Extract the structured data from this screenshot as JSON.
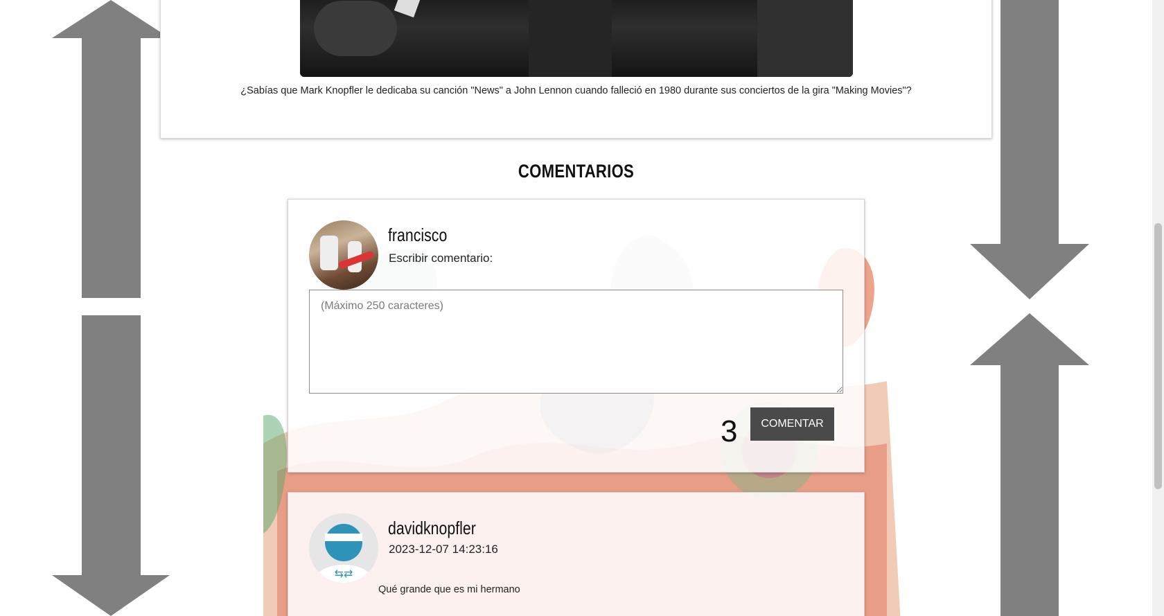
{
  "article": {
    "caption": "¿Sabías que Mark Knopfler le dedicaba su canción \"News\" a John Lennon cuando falleció en 1980 durante sus conciertos de la gira \"Making Movies\"?"
  },
  "comments_section": {
    "title": "COMENTARIOS"
  },
  "compose": {
    "username": "francisco",
    "prompt": "Escribir comentario:",
    "placeholder": "(Máximo 250 caracteres)",
    "char_count": "3",
    "submit_label": "COMENTAR"
  },
  "comments": [
    {
      "username": "davidknopfler",
      "timestamp": "2023-12-07 14:23:16",
      "text": "Qué grande que es mi hermano"
    }
  ],
  "colors": {
    "arrow": "#808080",
    "button": "#4a4a4a",
    "avatar_default": "#2e93b8"
  }
}
